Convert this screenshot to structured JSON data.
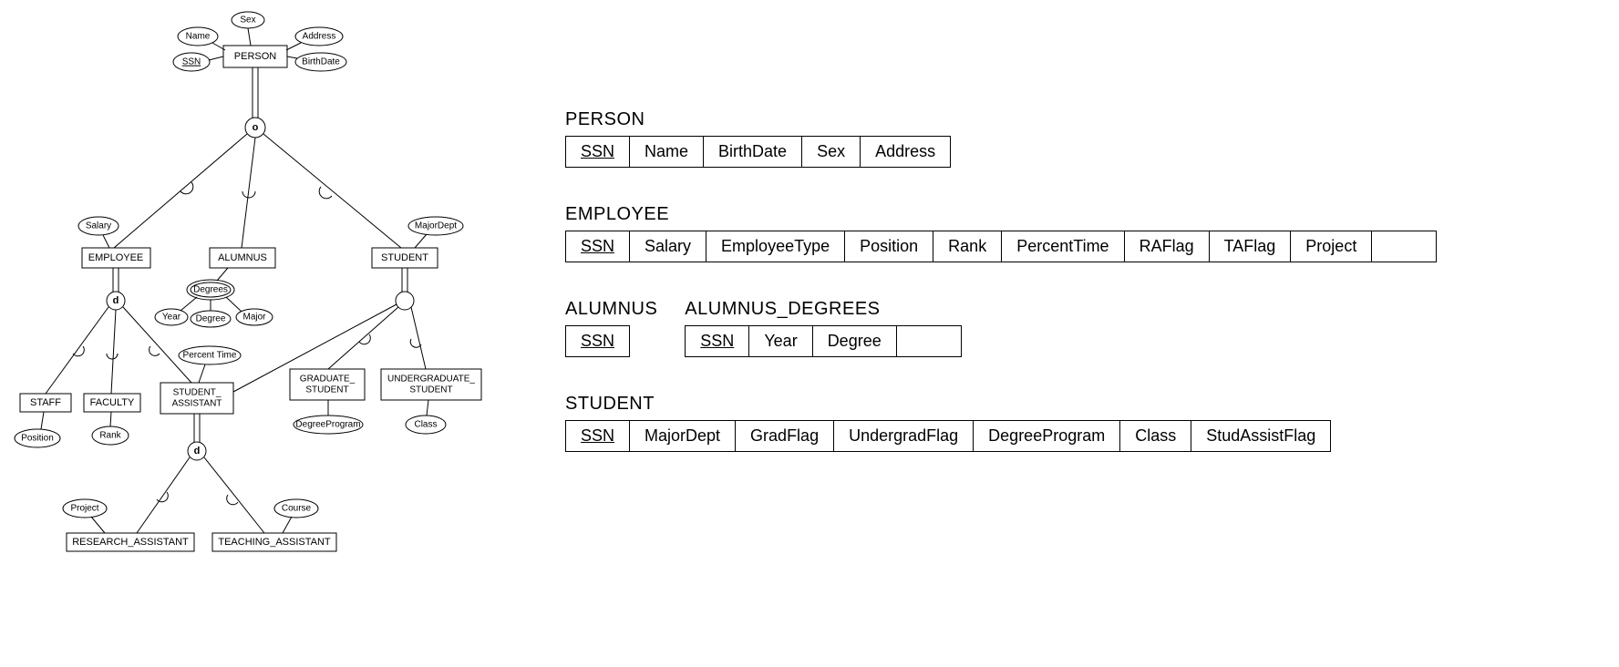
{
  "er": {
    "person": "PERSON",
    "employee": "EMPLOYEE",
    "alumnus": "ALUMNUS",
    "student": "STUDENT",
    "staff": "STAFF",
    "faculty": "FACULTY",
    "student_assistant": "STUDENT_\nASSISTANT",
    "graduate_student": "GRADUATE_\nSTUDENT",
    "undergraduate_student": "UNDERGRADUATE_\nSTUDENT",
    "research_assistant": "RESEARCH_ASSISTANT",
    "teaching_assistant": "TEACHING_ASSISTANT",
    "attrs": {
      "name": "Name",
      "sex": "Sex",
      "address": "Address",
      "ssn": "SSN",
      "birthdate": "BirthDate",
      "salary": "Salary",
      "majordept": "MajorDept",
      "degrees": "Degrees",
      "year": "Year",
      "degree": "Degree",
      "major": "Major",
      "percent_time": "Percent Time",
      "position": "Position",
      "rank": "Rank",
      "degreeprogram": "DegreeProgram",
      "class": "Class",
      "project": "Project",
      "course": "Course"
    },
    "constraint_o": "o",
    "constraint_d": "d"
  },
  "tables": {
    "person": {
      "title": "PERSON",
      "cols": [
        "SSN",
        "Name",
        "BirthDate",
        "Sex",
        "Address"
      ],
      "pk": [
        0
      ]
    },
    "employee": {
      "title": "EMPLOYEE",
      "cols": [
        "SSN",
        "Salary",
        "EmployeeType",
        "Position",
        "Rank",
        "PercentTime",
        "RAFlag",
        "TAFlag",
        "Project",
        ""
      ],
      "pk": [
        0
      ]
    },
    "alumnus": {
      "title": "ALUMNUS",
      "cols": [
        "SSN"
      ],
      "pk": [
        0
      ]
    },
    "alumnus_degrees": {
      "title": "ALUMNUS_DEGREES",
      "cols": [
        "SSN",
        "Year",
        "Degree",
        ""
      ],
      "pk": [
        0
      ]
    },
    "student": {
      "title": "STUDENT",
      "cols": [
        "SSN",
        "MajorDept",
        "GradFlag",
        "UndergradFlag",
        "DegreeProgram",
        "Class",
        "StudAssistFlag"
      ],
      "pk": [
        0
      ]
    }
  }
}
